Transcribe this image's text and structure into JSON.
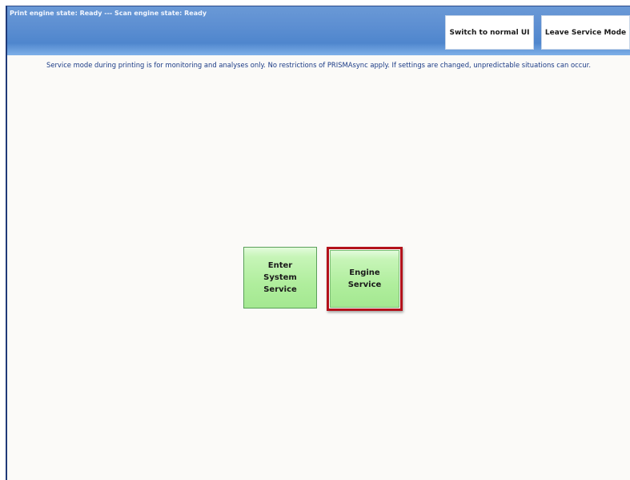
{
  "header": {
    "status": "Print engine state: Ready --- Scan engine state: Ready",
    "buttons": {
      "switch_normal_ui": "Switch to normal UI",
      "leave_service_mode": "Leave Service Mode"
    }
  },
  "notice": "Service mode during printing is for monitoring and analyses only. No restrictions of PRISMAsync apply. If settings are changed, unpredictable situations can occur.",
  "tiles": {
    "system_service": "Enter\nSystem\nService",
    "engine_service": "Engine\nService"
  },
  "colors": {
    "header_blue": "#5d8fd2",
    "tile_green": "#b0ee9d",
    "highlight_red": "#b3121b",
    "notice_text": "#1b3b86"
  }
}
